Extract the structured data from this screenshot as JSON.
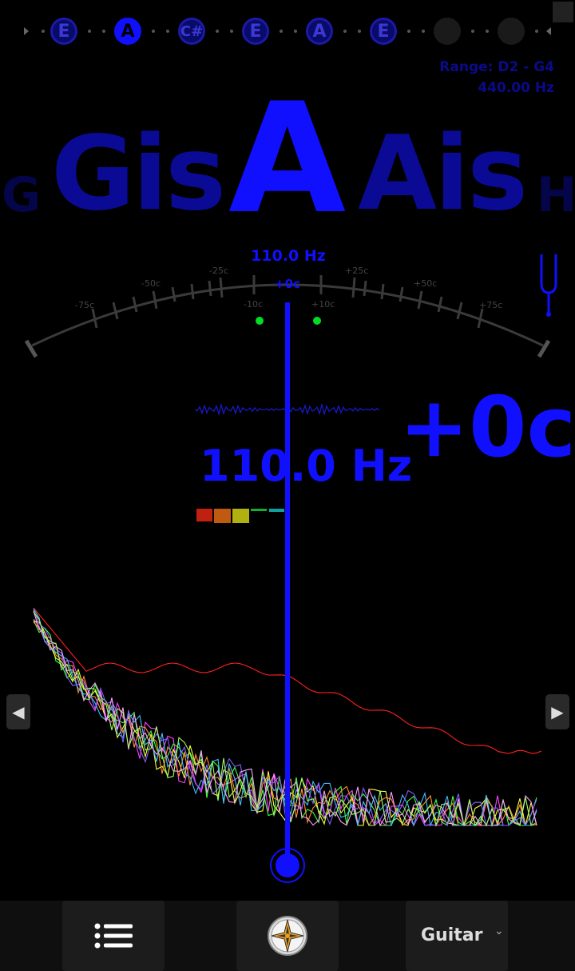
{
  "strings": [
    {
      "label": "E",
      "state": "normal"
    },
    {
      "label": "A",
      "state": "active"
    },
    {
      "label": "C#",
      "state": "normal"
    },
    {
      "label": "E",
      "state": "normal"
    },
    {
      "label": "A",
      "state": "normal"
    },
    {
      "label": "E",
      "state": "normal"
    },
    {
      "label": "",
      "state": "empty"
    },
    {
      "label": "",
      "state": "empty"
    }
  ],
  "range": {
    "text": "Range: D2 - G4",
    "ref": "440.00 Hz"
  },
  "notes": {
    "far_left": "G",
    "left": "Gis",
    "center": "A",
    "right": "Ais",
    "far_right": "H"
  },
  "meter": {
    "freq": "110.0 Hz",
    "cents": "+0c",
    "ticks": {
      "m75": "-75c",
      "m50": "-50c",
      "m25": "-25c",
      "m10": "-10c",
      "p10": "+10c",
      "p25": "+25c",
      "p50": "+50c",
      "p75": "+75c"
    }
  },
  "readout": {
    "freq": "110.0 Hz",
    "cents": "+0c"
  },
  "bottom": {
    "instrument": "Guitar"
  },
  "colors": {
    "accent": "#1010ff",
    "dim": "#0a0a8a",
    "green": "#00dd22",
    "spectrum_red": "#ff2020"
  }
}
